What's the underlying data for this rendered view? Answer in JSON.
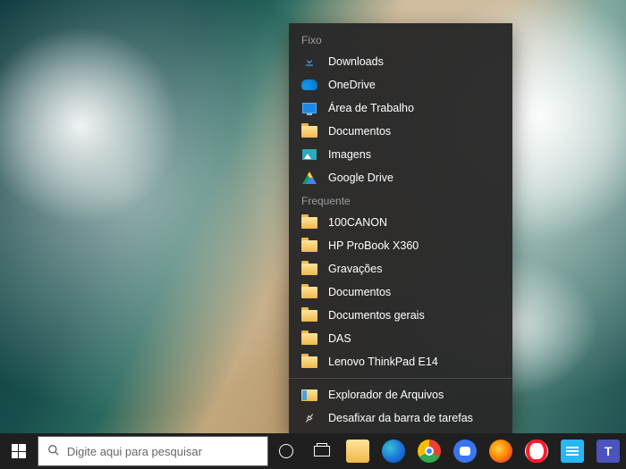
{
  "search": {
    "placeholder": "Digite aqui para pesquisar"
  },
  "jumplist": {
    "pinned_header": "Fixo",
    "frequent_header": "Frequente",
    "pinned": [
      {
        "label": "Downloads",
        "icon": "download-icon"
      },
      {
        "label": "OneDrive",
        "icon": "onedrive-icon"
      },
      {
        "label": "Área de Trabalho",
        "icon": "desktop-icon"
      },
      {
        "label": "Documentos",
        "icon": "folder-icon"
      },
      {
        "label": "Imagens",
        "icon": "images-icon"
      },
      {
        "label": "Google Drive",
        "icon": "gdrive-icon"
      }
    ],
    "frequent": [
      {
        "label": "100CANON",
        "icon": "folder-icon"
      },
      {
        "label": "HP ProBook X360",
        "icon": "folder-icon"
      },
      {
        "label": "Gravações",
        "icon": "folder-icon"
      },
      {
        "label": "Documentos",
        "icon": "folder-icon"
      },
      {
        "label": "Documentos gerais",
        "icon": "folder-icon"
      },
      {
        "label": "DAS",
        "icon": "folder-icon"
      },
      {
        "label": "Lenovo ThinkPad E14",
        "icon": "folder-icon"
      }
    ],
    "actions": {
      "open_explorer": "Explorador de Arquivos",
      "unpin": "Desafixar da barra de tarefas"
    }
  },
  "taskbar": {
    "apps": [
      {
        "name": "cortana",
        "icon": "circle-icon"
      },
      {
        "name": "task-view",
        "icon": "taskview-icon"
      },
      {
        "name": "file-explorer",
        "icon": "explorer-icon"
      },
      {
        "name": "microsoft-edge",
        "icon": "edge-icon"
      },
      {
        "name": "google-chrome",
        "icon": "chrome-icon"
      },
      {
        "name": "signal",
        "icon": "signal-icon"
      },
      {
        "name": "firefox",
        "icon": "firefox-icon"
      },
      {
        "name": "opera",
        "icon": "opera-icon"
      },
      {
        "name": "notes",
        "icon": "notes-icon"
      },
      {
        "name": "microsoft-teams",
        "icon": "teams-icon",
        "letter": "T"
      }
    ]
  }
}
